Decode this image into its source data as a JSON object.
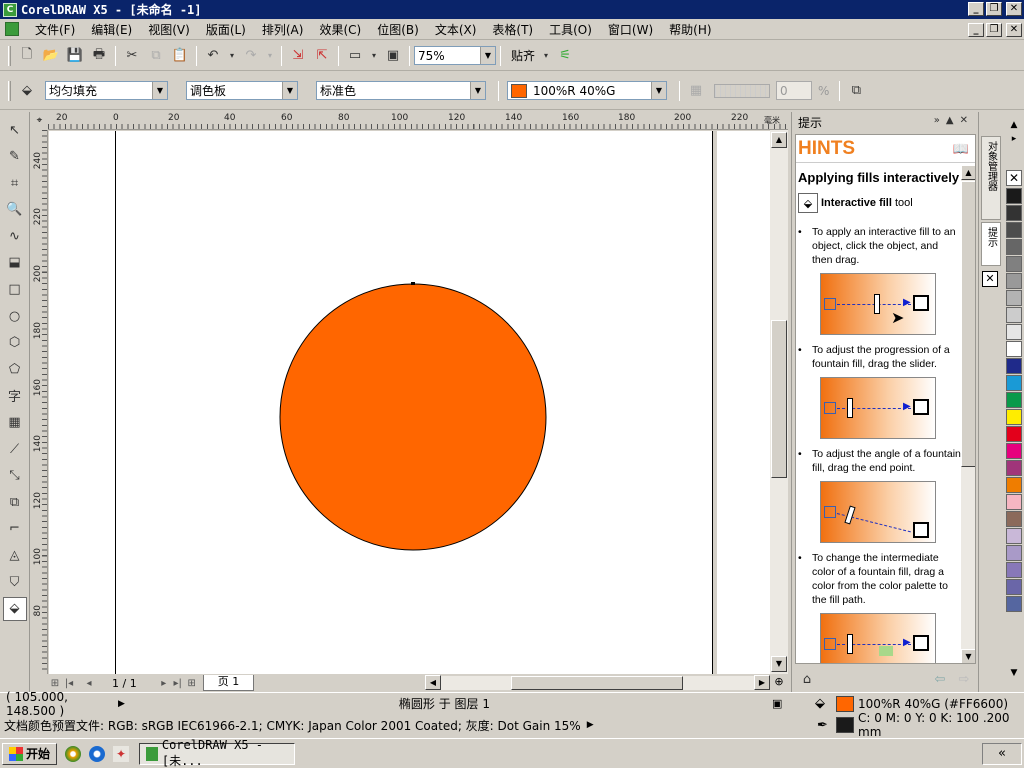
{
  "window": {
    "title": "CorelDRAW X5 - [未命名 -1]"
  },
  "menu": [
    "文件(F)",
    "编辑(E)",
    "视图(V)",
    "版面(L)",
    "排列(A)",
    "效果(C)",
    "位图(B)",
    "文本(X)",
    "表格(T)",
    "工具(O)",
    "窗口(W)",
    "帮助(H)"
  ],
  "toolbar": {
    "zoom": "75%",
    "snap_label": "贴齐"
  },
  "propbar": {
    "fill_type": "均匀填充",
    "color_model": "调色板",
    "palette": "标准色",
    "color_value": "100%R 40%G",
    "color_swatch": "#FF6600",
    "transparency_value": "0",
    "percent_sign": "%"
  },
  "rulers": {
    "horizontal": [
      "20",
      "0",
      "20",
      "40",
      "60",
      "80",
      "100",
      "120",
      "140",
      "160",
      "180",
      "200",
      "220"
    ],
    "horizontal_unit": "毫米",
    "vertical": [
      "240",
      "220",
      "200",
      "180",
      "160",
      "140",
      "120",
      "100",
      "80"
    ]
  },
  "canvas": {
    "shape": "ellipse",
    "fill_color": "#FF6600",
    "outline_color": "#000000"
  },
  "page_nav": {
    "page_count": "1 / 1",
    "page_tab": "页 1"
  },
  "docker": {
    "title": "提示",
    "hints_header": "HINTS",
    "heading": "Applying fills interactively",
    "tool_name": "Interactive fill",
    "tool_suffix": "tool",
    "hints": [
      "To apply an interactive fill to an object, click the object, and then drag.",
      "To adjust the progression of a fountain fill, drag the slider.",
      "To adjust the angle of a fountain fill, drag the end point.",
      "To change the intermediate color of a fountain fill, drag a color from the color palette to the fill path."
    ]
  },
  "docker_tabs": [
    "对象管理器",
    "提示"
  ],
  "palette": [
    "#1a1a1a",
    "#333333",
    "#4d4d4d",
    "#666666",
    "#808080",
    "#999999",
    "#b3b3b3",
    "#cccccc",
    "#e6e6e6",
    "#ffffff",
    "#1f2a8a",
    "#1a9ad6",
    "#0a9a4a",
    "#ffed00",
    "#e3001b",
    "#e6007e",
    "#a0357a",
    "#ef7d00",
    "#f6b6c2",
    "#8b6a5b",
    "#c9b8d8",
    "#a99ac8",
    "#8878b8",
    "#6a66a8",
    "#5566a0"
  ],
  "status": {
    "coordinates": "( 105.000, 148.500 )",
    "object_info": "椭圆形 于 图层 1",
    "fill_info": "100%R 40%G (#FF6600)",
    "fill_swatch": "#FF6600",
    "outline_info": "C: 0 M: 0 Y: 0 K: 100  .200 mm",
    "outline_swatch": "#1a1a1a",
    "color_profile": "文档颜色预置文件: RGB: sRGB IEC61966-2.1; CMYK: Japan Color 2001 Coated; 灰度: Dot Gain 15%"
  },
  "taskbar": {
    "start_label": "开始",
    "task_label": "CorelDRAW X5 - [未...",
    "tray": "«"
  }
}
